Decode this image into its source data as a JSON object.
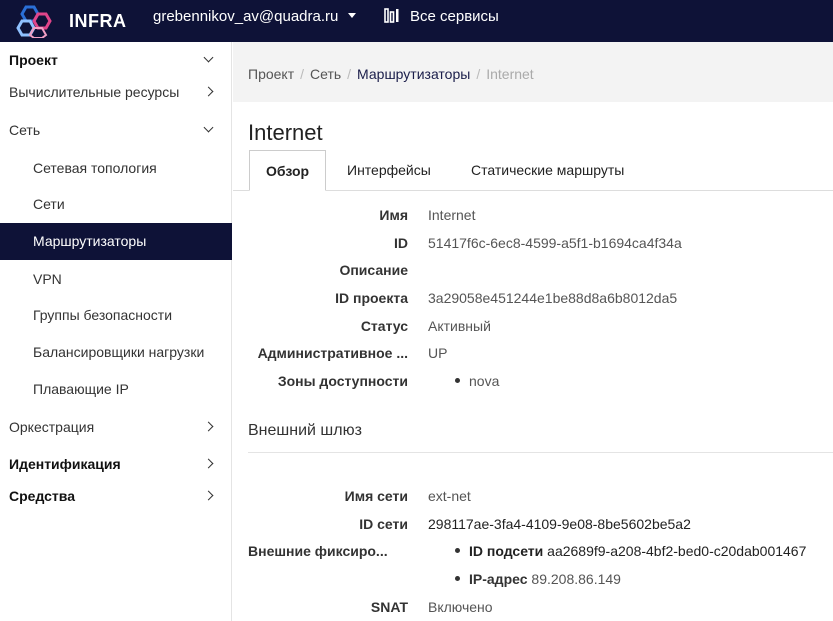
{
  "header": {
    "logo_text": "INFRA",
    "user": "grebennikov_av@quadra.ru",
    "services_label": "Все сервисы",
    "colors": {
      "bar": "#0e1237",
      "accent_blue": "#2a6fd6",
      "accent_pink": "#e0458a"
    }
  },
  "sidebar": {
    "items": [
      {
        "label": "Проект",
        "chevron": "down"
      },
      {
        "label": "Вычислительные ресурсы",
        "chevron": "right"
      },
      {
        "label": "Сеть",
        "chevron": "down"
      },
      {
        "label": "Сетевая топология"
      },
      {
        "label": "Сети"
      },
      {
        "label": "Маршрутизаторы",
        "active": true
      },
      {
        "label": "VPN"
      },
      {
        "label": "Группы безопасности"
      },
      {
        "label": "Балансировщики нагрузки"
      },
      {
        "label": "Плавающие IP"
      },
      {
        "label": "Оркестрация",
        "chevron": "right"
      },
      {
        "label": "Идентификация",
        "chevron": "right"
      },
      {
        "label": "Средства",
        "chevron": "right"
      }
    ]
  },
  "breadcrumb": {
    "items": [
      "Проект",
      "Сеть",
      "Маршрутизаторы",
      "Internet"
    ]
  },
  "page": {
    "title": "Internet",
    "tabs": [
      "Обзор",
      "Интерфейсы",
      "Статические маршруты"
    ]
  },
  "overview": {
    "name_label": "Имя",
    "name_value": "Internet",
    "id_label": "ID",
    "id_value": "51417f6c-6ec8-4599-a5f1-b1694ca4f34a",
    "desc_label": "Описание",
    "project_label": "ID проекта",
    "project_value": "3a29058e451244e1be88d8a6b8012da5",
    "status_label": "Статус",
    "status_value": "Активный",
    "admin_label": "Административное ...",
    "admin_value": "UP",
    "zones_label": "Зоны доступности",
    "zones_value": "nova"
  },
  "gateway": {
    "section_title": "Внешний шлюз",
    "net_name_label": "Имя сети",
    "net_name_value": "ext-net",
    "net_id_label": "ID сети",
    "net_id_value": "298117ae-3fa4-4109-9e08-8be5602be5a2",
    "fixed_label": "Внешние фиксиро...",
    "subnet_key": "ID подсети",
    "subnet_value": "aa2689f9-a208-4bf2-bed0-c20dab001467",
    "ip_key": "IP-адрес",
    "ip_value": "89.208.86.149",
    "snat_label": "SNAT",
    "snat_value": "Включено"
  }
}
